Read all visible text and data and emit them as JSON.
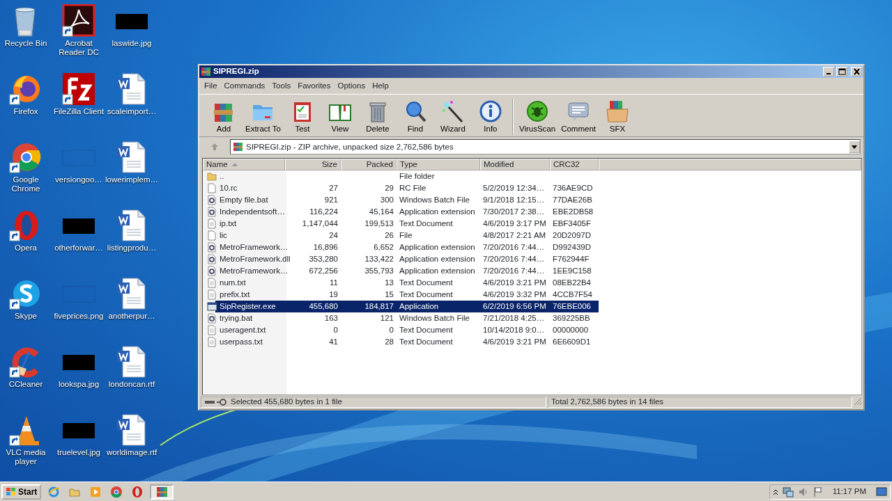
{
  "desktop": {
    "icons": [
      {
        "label": "Recycle Bin",
        "kind": "recycle",
        "shortcut": false
      },
      {
        "label": "Firefox",
        "kind": "firefox",
        "shortcut": true
      },
      {
        "label": "Google Chrome",
        "kind": "chrome",
        "shortcut": true
      },
      {
        "label": "Opera",
        "kind": "opera",
        "shortcut": true
      },
      {
        "label": "Skype",
        "kind": "skype",
        "shortcut": true
      },
      {
        "label": "CCleaner",
        "kind": "ccleaner",
        "shortcut": true
      },
      {
        "label": "VLC media player",
        "kind": "vlc",
        "shortcut": true
      },
      {
        "label": "Acrobat Reader DC",
        "kind": "acrobat",
        "shortcut": true
      },
      {
        "label": "FileZilla Client",
        "kind": "filezilla",
        "shortcut": true
      },
      {
        "label": "versiongoo…",
        "kind": "blank-image",
        "shortcut": false
      },
      {
        "label": "otherforwar…",
        "kind": "dark-image",
        "shortcut": false
      },
      {
        "label": "fiveprices.png",
        "kind": "blank-image",
        "shortcut": false
      },
      {
        "label": "lookspa.jpg",
        "kind": "dark-image",
        "shortcut": false
      },
      {
        "label": "truelevel.jpg",
        "kind": "dark-image",
        "shortcut": false
      },
      {
        "label": "laswide.jpg",
        "kind": "dark-image",
        "shortcut": false
      },
      {
        "label": "scaleimport…",
        "kind": "word",
        "shortcut": false
      },
      {
        "label": "lowerimplem…",
        "kind": "word",
        "shortcut": false
      },
      {
        "label": "listingprodu…",
        "kind": "word",
        "shortcut": false
      },
      {
        "label": "anotherpur…",
        "kind": "word",
        "shortcut": false
      },
      {
        "label": "londoncan.rtf",
        "kind": "word",
        "shortcut": false
      },
      {
        "label": "worldimage.rtf",
        "kind": "word",
        "shortcut": false
      }
    ]
  },
  "window": {
    "title": "SIPREGI.zip",
    "menu": [
      "File",
      "Commands",
      "Tools",
      "Favorites",
      "Options",
      "Help"
    ],
    "toolbar": {
      "groups": [
        [
          {
            "label": "Add",
            "kind": "add"
          },
          {
            "label": "Extract To",
            "kind": "extract"
          },
          {
            "label": "Test",
            "kind": "test"
          },
          {
            "label": "View",
            "kind": "view"
          },
          {
            "label": "Delete",
            "kind": "delete"
          },
          {
            "label": "Find",
            "kind": "find"
          },
          {
            "label": "Wizard",
            "kind": "wizard"
          },
          {
            "label": "Info",
            "kind": "info"
          }
        ],
        [
          {
            "label": "VirusScan",
            "kind": "virus"
          },
          {
            "label": "Comment",
            "kind": "comment"
          },
          {
            "label": "SFX",
            "kind": "sfx"
          }
        ]
      ]
    },
    "address": {
      "text": "SIPREGI.zip - ZIP archive, unpacked size 2,762,586 bytes"
    },
    "table": {
      "columns": [
        {
          "label": "Name",
          "kind": "text",
          "sorted": true
        },
        {
          "label": "Size",
          "kind": "number",
          "sorted": false
        },
        {
          "label": "Packed",
          "kind": "number",
          "sorted": false
        },
        {
          "label": "Type",
          "kind": "text",
          "sorted": false
        },
        {
          "label": "Modified",
          "kind": "text",
          "sorted": false
        },
        {
          "label": "CRC32",
          "kind": "text",
          "sorted": false
        }
      ],
      "rows": [
        {
          "kind": "folder",
          "selected": false,
          "cells": [
            "..",
            "",
            "",
            "File folder",
            "",
            ""
          ]
        },
        {
          "kind": "file",
          "selected": false,
          "cells": [
            "10.rc",
            "27",
            "29",
            "RC File",
            "5/2/2019 12:34…",
            "736AE9CD"
          ]
        },
        {
          "kind": "gear",
          "selected": false,
          "cells": [
            "Empty file.bat",
            "921",
            "300",
            "Windows Batch File",
            "9/1/2018 12:15…",
            "77DAE26B"
          ]
        },
        {
          "kind": "gear",
          "selected": false,
          "cells": [
            "Independentsoft…",
            "116,224",
            "45,164",
            "Application extension",
            "7/30/2017 2:38…",
            "EBE2DB58"
          ]
        },
        {
          "kind": "text",
          "selected": false,
          "cells": [
            "ip.txt",
            "1,147,044",
            "199,513",
            "Text Document",
            "4/6/2019 3:17 PM",
            "EBF3405F"
          ]
        },
        {
          "kind": "file",
          "selected": false,
          "cells": [
            "lic",
            "24",
            "26",
            "File",
            "4/8/2017 2:21 AM",
            "20D2097D"
          ]
        },
        {
          "kind": "gear",
          "selected": false,
          "cells": [
            "MetroFramework…",
            "16,896",
            "6,652",
            "Application extension",
            "7/20/2016 7:44…",
            "D992439D"
          ]
        },
        {
          "kind": "gear",
          "selected": false,
          "cells": [
            "MetroFramework.dll",
            "353,280",
            "133,422",
            "Application extension",
            "7/20/2016 7:44…",
            "F762944F"
          ]
        },
        {
          "kind": "gear",
          "selected": false,
          "cells": [
            "MetroFramework…",
            "672,256",
            "355,793",
            "Application extension",
            "7/20/2016 7:44…",
            "1EE9C158"
          ]
        },
        {
          "kind": "text",
          "selected": false,
          "cells": [
            "num.txt",
            "11",
            "13",
            "Text Document",
            "4/6/2019 3:21 PM",
            "08EB22B4"
          ]
        },
        {
          "kind": "text",
          "selected": false,
          "cells": [
            "prefix.txt",
            "19",
            "15",
            "Text Document",
            "4/6/2019 3:32 PM",
            "4CCB7F54"
          ]
        },
        {
          "kind": "exe",
          "selected": true,
          "cells": [
            "SipRegister.exe",
            "455,680",
            "184,817",
            "Application",
            "6/2/2019 6:56 PM",
            "76EBE006"
          ]
        },
        {
          "kind": "gear",
          "selected": false,
          "cells": [
            "trying.bat",
            "163",
            "121",
            "Windows Batch File",
            "7/21/2018 4:25…",
            "369225BB"
          ]
        },
        {
          "kind": "text",
          "selected": false,
          "cells": [
            "useragent.txt",
            "0",
            "0",
            "Text Document",
            "10/14/2018 9:0…",
            "00000000"
          ]
        },
        {
          "kind": "text",
          "selected": false,
          "cells": [
            "userpass.txt",
            "41",
            "28",
            "Text Document",
            "4/6/2019 3:21 PM",
            "6E6609D1"
          ]
        }
      ]
    },
    "status_bar": {
      "left": "Selected 455,680 bytes in 1 file",
      "right": "Total 2,762,586 bytes in 14 files"
    }
  },
  "taskbar": {
    "start": "Start",
    "apps": [
      {
        "kind": "ie",
        "active": false
      },
      {
        "kind": "explorer",
        "active": false
      },
      {
        "kind": "media",
        "active": false
      },
      {
        "kind": "chrome",
        "active": false
      },
      {
        "kind": "opera",
        "active": false
      },
      {
        "kind": "winrar",
        "active": true
      }
    ],
    "clock": "11:17 PM"
  }
}
